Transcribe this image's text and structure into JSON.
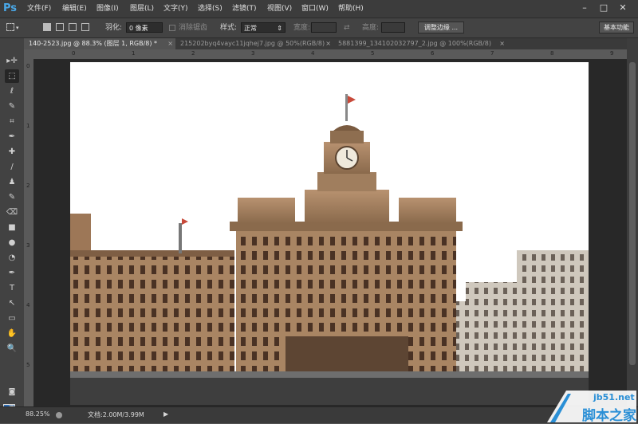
{
  "app": {
    "logo": "Ps"
  },
  "menu": [
    "文件(F)",
    "编辑(E)",
    "图像(I)",
    "图层(L)",
    "文字(Y)",
    "选择(S)",
    "滤镜(T)",
    "视图(V)",
    "窗口(W)",
    "帮助(H)"
  ],
  "window_controls": {
    "minimize": "–",
    "maximize": "□",
    "close": "✕"
  },
  "options": {
    "feather_label": "羽化:",
    "feather_value": "0 像素",
    "antialias_label": "消除锯齿",
    "style_label": "样式:",
    "style_value": "正常",
    "width_label": "宽度:",
    "height_label": "高度:",
    "swap_icon": "⇄",
    "refine_edge_button": "调整边缘 ...",
    "workspace_button": "基本功能"
  },
  "tabs": [
    {
      "label": "140-2523.jpg @ 88.3% (图层 1, RGB/8) *",
      "close": "×",
      "active": true
    },
    {
      "label": "215202byq4vayc11jqhej7.jpg @ 50%(RGB/8)",
      "close": "×",
      "active": false
    },
    {
      "label": "5881399_134102032797_2.jpg @ 100%(RGB/8)",
      "close": "×",
      "active": false
    }
  ],
  "tools": [
    "▸✛",
    "⬚",
    "ℓ",
    "✎",
    "⌗",
    "✒",
    "✚",
    "/",
    "♟",
    "✎",
    "⌫",
    "■",
    "●",
    "◔",
    "✒",
    "T",
    "↖",
    "▭",
    "✋",
    "🔍"
  ],
  "ruler_h": [
    "0",
    "1",
    "2",
    "3",
    "4",
    "5",
    "6",
    "7",
    "8",
    "9"
  ],
  "ruler_v": [
    "0",
    "1",
    "2",
    "3",
    "4",
    "5"
  ],
  "status": {
    "zoom": "88.25%",
    "doc_info": "文档:2.00M/3.99M",
    "arrow": "▶"
  },
  "watermark": {
    "site": "jb51.net",
    "name": "脚本之家"
  },
  "colors": {
    "accent": "#2e6db4",
    "chrome": "#3c3c3c",
    "canvas": "#282828"
  }
}
